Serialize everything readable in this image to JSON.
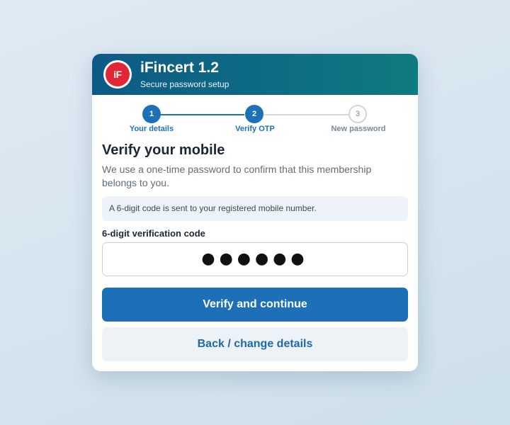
{
  "app": {
    "logo_text": "iF",
    "title": "iFincert 1.2",
    "subtitle": "Secure password setup"
  },
  "steps": [
    {
      "number": "1",
      "label": "Your details",
      "state": "complete"
    },
    {
      "number": "2",
      "label": "Verify OTP",
      "state": "active"
    },
    {
      "number": "3",
      "label": "New password",
      "state": "upcoming"
    }
  ],
  "page": {
    "title": "Verify your mobile",
    "description": "We use a one-time password to confirm that this membership belongs to you.",
    "notice": "A 6-digit code is sent to your registered mobile number."
  },
  "form": {
    "code_label": "6-digit verification code",
    "code_value_masked": "●●●●●●"
  },
  "actions": {
    "primary_label": "Verify and continue",
    "secondary_label": "Back / change details"
  },
  "colors": {
    "accent": "#1d70b8",
    "header_start": "#0e5a86",
    "header_end": "#0f7a80",
    "logo_red": "#e32636"
  }
}
